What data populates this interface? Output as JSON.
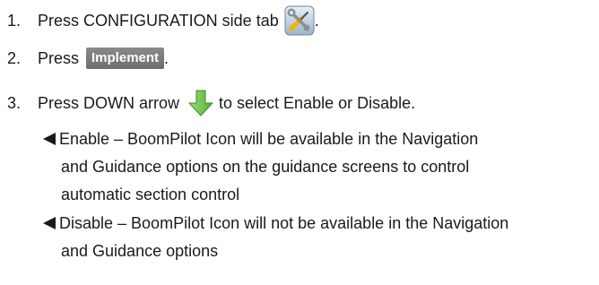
{
  "steps": [
    {
      "number": "1.",
      "before": "Press CONFIGURATION side tab",
      "icon": "configuration-tools-icon",
      "after": "."
    },
    {
      "number": "2.",
      "before": "Press",
      "button": "Implement",
      "after": "."
    },
    {
      "number": "3.",
      "before": "Press DOWN arrow",
      "icon": "down-arrow-icon",
      "after": "to select Enable or Disable."
    }
  ],
  "bullets": [
    {
      "lines": [
        "Enable – BoomPilot Icon will be available in the Navigation",
        "and Guidance options on the guidance screens to control",
        "automatic section control"
      ]
    },
    {
      "lines": [
        "Disable – BoomPilot Icon will not be available in the Navigation",
        "and Guidance options"
      ]
    }
  ],
  "colors": {
    "text": "#1a1a1a",
    "button_bg": "#7a7a7a",
    "button_text": "#ffffff",
    "arrow_green": "#6cc24a"
  }
}
